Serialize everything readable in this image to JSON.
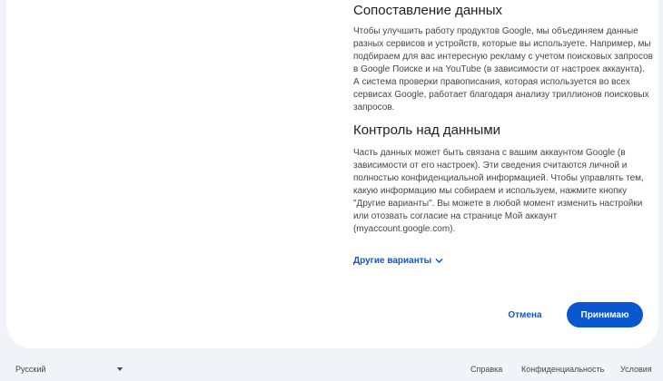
{
  "sections": [
    {
      "title": "Сопоставление данных",
      "text": "Чтобы улучшить работу продуктов Google, мы объединяем данные разных сервисов и устройств, которые вы используете. Например, мы подбираем для вас интересную рекламу с учетом поисковых запросов в Google Поиске и на YouTube (в зависимости от настроек аккаунта). А система проверки правописания, которая используется во всех сервисах Google, работает благодаря анализу триллионов поисковых запросов."
    },
    {
      "title": "Контроль над данными",
      "text": "Часть данных может быть связана с вашим аккаунтом Google (в зависимости от его настроек). Эти сведения считаются личной и полностью конфиденциальной информацией. Чтобы управлять тем, какую информацию мы собираем и используем, нажмите кнопку \"Другие варианты\". Вы можете в любой момент изменить настройки или отозвать согласие на странице Мой аккаунт (myaccount.google.com)."
    }
  ],
  "more_options": {
    "label": "Другие варианты",
    "icon": "chevron-down-icon"
  },
  "actions": {
    "cancel_label": "Отмена",
    "accept_label": "Принимаю"
  },
  "footer": {
    "language": {
      "selected": "Русский",
      "icon": "caret-down-icon"
    },
    "links": [
      {
        "label": "Справка"
      },
      {
        "label": "Конфиденциальность"
      },
      {
        "label": "Условия"
      }
    ]
  },
  "colors": {
    "accent": "#0b57d0",
    "page_background": "#f0f4f9",
    "card_background": "#ffffff",
    "heading_text": "#1f1f1f",
    "body_text": "#444746"
  }
}
